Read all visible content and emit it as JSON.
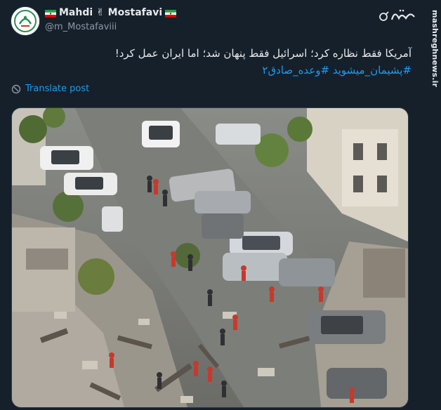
{
  "author": {
    "display_name": "Mahdi ✌ Mostafavi",
    "handle": "@m_Mostafaviii"
  },
  "tweet": {
    "text": "آمریکا فقط نظاره کرد؛ اسرائیل فقط پنهان شد؛ اما ایران عمل کرد!",
    "hashtags": "#پشیمان_میشوید #وعده_صادق۲"
  },
  "translate_label": "Translate post",
  "watermark": {
    "site": "mashreghnews.ir"
  },
  "icons": [
    "verified-grok-icon",
    "globe-icon",
    "iran-flag-icon"
  ],
  "colors": {
    "background": "#15202b",
    "link": "#1d9bf0",
    "text": "#e7e9ea",
    "muted": "#8b98a5"
  }
}
